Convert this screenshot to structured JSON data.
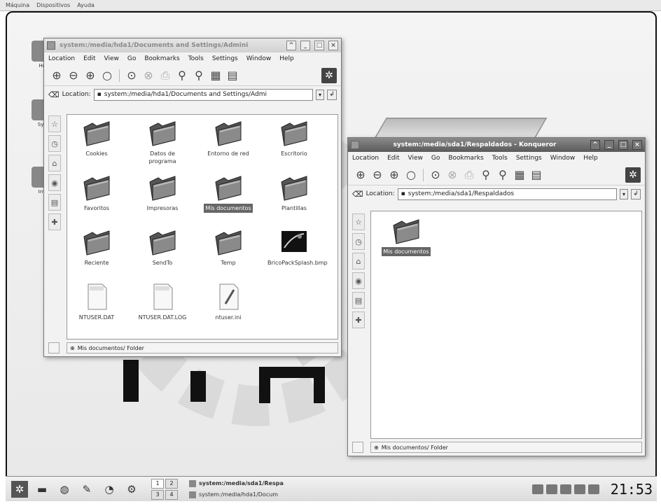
{
  "vm_menu": [
    "Máquina",
    "Dispositivos",
    "Ayuda"
  ],
  "desktop_icons": [
    "Ho",
    "Sys",
    "Inv"
  ],
  "win1": {
    "title": "system:/media/hda1/Documents and Settings/Admini",
    "menu": [
      "Location",
      "Edit",
      "View",
      "Go",
      "Bookmarks",
      "Tools",
      "Settings",
      "Window",
      "Help"
    ],
    "location_label": "Location:",
    "location_value": "system:/media/hda1/Documents and Settings/Admi",
    "files": [
      {
        "name": "Cookies",
        "icon": "folder-icon"
      },
      {
        "name": "Datos de programa",
        "icon": "folder-icon"
      },
      {
        "name": "Entorno de red",
        "icon": "folder-icon"
      },
      {
        "name": "Escritorio",
        "icon": "folder-icon"
      },
      {
        "name": "Favoritos",
        "icon": "folder-icon"
      },
      {
        "name": "Impresoras",
        "icon": "folder-icon"
      },
      {
        "name": "Mis documentos",
        "icon": "folder-icon",
        "selected": true
      },
      {
        "name": "Plantillas",
        "icon": "folder-icon"
      },
      {
        "name": "Reciente",
        "icon": "folder-icon"
      },
      {
        "name": "SendTo",
        "icon": "folder-icon"
      },
      {
        "name": "Temp",
        "icon": "folder-icon"
      },
      {
        "name": "BricoPackSplash.bmp",
        "icon": "image-file-icon"
      },
      {
        "name": "NTUSER.DAT",
        "icon": "document-icon"
      },
      {
        "name": "NTUSER.DAT.LOG",
        "icon": "document-icon"
      },
      {
        "name": "ntuser.ini",
        "icon": "text-file-icon"
      }
    ],
    "status": "Mis documentos/  Folder"
  },
  "win2": {
    "title": "system:/media/sda1/Respaldados - Konqueror",
    "menu": [
      "Location",
      "Edit",
      "View",
      "Go",
      "Bookmarks",
      "Tools",
      "Settings",
      "Window",
      "Help"
    ],
    "location_label": "Location:",
    "location_value": "system:/media/sda1/Respaldados",
    "files": [
      {
        "name": "Mis documentos",
        "icon": "folder-icon",
        "selected": true
      }
    ],
    "status": "Mis documentos/  Folder"
  },
  "taskbar": {
    "pager": [
      "1",
      "2",
      "3",
      "4"
    ],
    "tasks": [
      {
        "label": "system:/media/sda1/Respa",
        "active": true
      },
      {
        "label": "system:/media/hda1/Docum",
        "active": false
      }
    ],
    "clock": "21:53"
  }
}
